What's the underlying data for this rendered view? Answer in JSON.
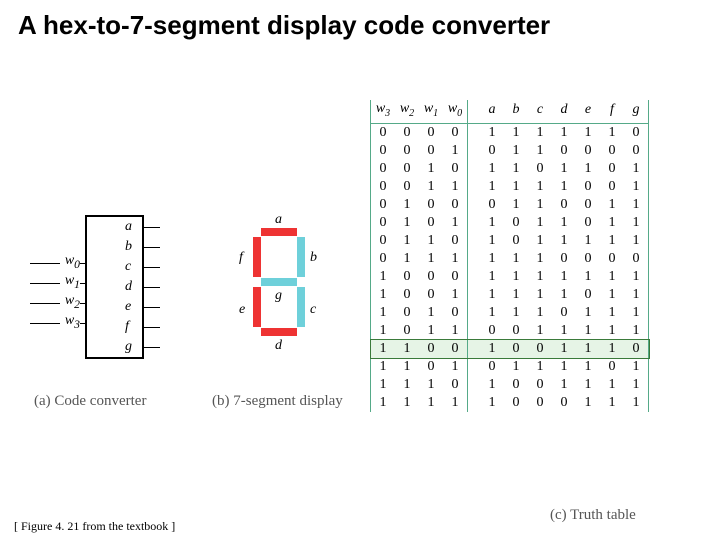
{
  "title": "A hex-to-7-segment display code converter",
  "captions": {
    "a": "(a) Code converter",
    "b": "(b) 7-segment display",
    "c": "(c) Truth table"
  },
  "citation": "[ Figure 4. 21 from the textbook ]",
  "converter": {
    "inputs": [
      "w0",
      "w1",
      "w2",
      "w3"
    ],
    "outputs": [
      "a",
      "b",
      "c",
      "d",
      "e",
      "f",
      "g"
    ]
  },
  "segments": {
    "a": {
      "label": "a",
      "on": true
    },
    "b": {
      "label": "b",
      "on": false
    },
    "c": {
      "label": "c",
      "on": false
    },
    "d": {
      "label": "d",
      "on": true
    },
    "e": {
      "label": "e",
      "on": true
    },
    "f": {
      "label": "f",
      "on": true
    },
    "g": {
      "label": "g",
      "on": false
    }
  },
  "table": {
    "inputs": [
      "w3",
      "w2",
      "w1",
      "w0"
    ],
    "outputs": [
      "a",
      "b",
      "c",
      "d",
      "e",
      "f",
      "g"
    ],
    "highlight_index": 12,
    "rows": [
      {
        "in": [
          0,
          0,
          0,
          0
        ],
        "out": [
          1,
          1,
          1,
          1,
          1,
          1,
          0
        ]
      },
      {
        "in": [
          0,
          0,
          0,
          1
        ],
        "out": [
          0,
          1,
          1,
          0,
          0,
          0,
          0
        ]
      },
      {
        "in": [
          0,
          0,
          1,
          0
        ],
        "out": [
          1,
          1,
          0,
          1,
          1,
          0,
          1
        ]
      },
      {
        "in": [
          0,
          0,
          1,
          1
        ],
        "out": [
          1,
          1,
          1,
          1,
          0,
          0,
          1
        ]
      },
      {
        "in": [
          0,
          1,
          0,
          0
        ],
        "out": [
          0,
          1,
          1,
          0,
          0,
          1,
          1
        ]
      },
      {
        "in": [
          0,
          1,
          0,
          1
        ],
        "out": [
          1,
          0,
          1,
          1,
          0,
          1,
          1
        ]
      },
      {
        "in": [
          0,
          1,
          1,
          0
        ],
        "out": [
          1,
          0,
          1,
          1,
          1,
          1,
          1
        ]
      },
      {
        "in": [
          0,
          1,
          1,
          1
        ],
        "out": [
          1,
          1,
          1,
          0,
          0,
          0,
          0
        ]
      },
      {
        "in": [
          1,
          0,
          0,
          0
        ],
        "out": [
          1,
          1,
          1,
          1,
          1,
          1,
          1
        ]
      },
      {
        "in": [
          1,
          0,
          0,
          1
        ],
        "out": [
          1,
          1,
          1,
          1,
          0,
          1,
          1
        ]
      },
      {
        "in": [
          1,
          0,
          1,
          0
        ],
        "out": [
          1,
          1,
          1,
          0,
          1,
          1,
          1
        ]
      },
      {
        "in": [
          1,
          0,
          1,
          1
        ],
        "out": [
          0,
          0,
          1,
          1,
          1,
          1,
          1
        ]
      },
      {
        "in": [
          1,
          1,
          0,
          0
        ],
        "out": [
          1,
          0,
          0,
          1,
          1,
          1,
          0
        ]
      },
      {
        "in": [
          1,
          1,
          0,
          1
        ],
        "out": [
          0,
          1,
          1,
          1,
          1,
          0,
          1
        ]
      },
      {
        "in": [
          1,
          1,
          1,
          0
        ],
        "out": [
          1,
          0,
          0,
          1,
          1,
          1,
          1
        ]
      },
      {
        "in": [
          1,
          1,
          1,
          1
        ],
        "out": [
          1,
          0,
          0,
          0,
          1,
          1,
          1
        ]
      }
    ]
  }
}
